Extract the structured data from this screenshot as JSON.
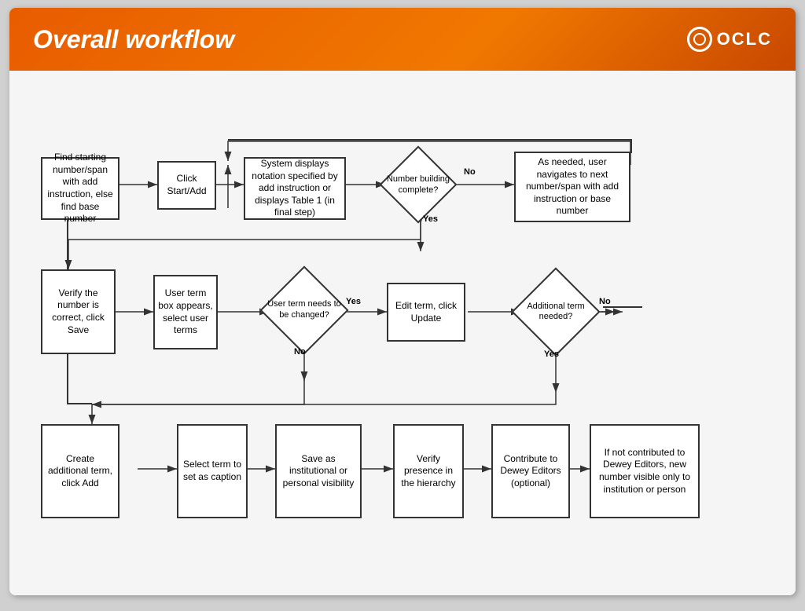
{
  "header": {
    "title": "Overall workflow",
    "logo_text": "OCLC"
  },
  "flowchart": {
    "row1_boxes": [
      {
        "id": "b1",
        "text": "Find starting number/span with add instruction, else find base number"
      },
      {
        "id": "b2",
        "text": "Click Start/Add"
      },
      {
        "id": "b3",
        "text": "System displays notation specified by add instruction or displays Table 1 (in final step)"
      },
      {
        "id": "d1",
        "text": "Number building complete?",
        "type": "diamond"
      },
      {
        "id": "b4",
        "text": "As needed, user navigates to next number/span with add instruction or base number"
      }
    ],
    "row2_boxes": [
      {
        "id": "b5",
        "text": "Verify the number is correct, click Save"
      },
      {
        "id": "b6",
        "text": "User term box appears, select user terms"
      },
      {
        "id": "d2",
        "text": "User term needs to be changed?",
        "type": "diamond"
      },
      {
        "id": "b7",
        "text": "Edit term, click Update"
      },
      {
        "id": "d3",
        "text": "Additional term needed?",
        "type": "diamond"
      }
    ],
    "row3_boxes": [
      {
        "id": "b8",
        "text": "Create additional term, click Add"
      },
      {
        "id": "b9",
        "text": "Select term to set as caption"
      },
      {
        "id": "b10",
        "text": "Save as institutional or personal visibility"
      },
      {
        "id": "b11",
        "text": "Verify presence in the hierarchy"
      },
      {
        "id": "b12",
        "text": "Contribute to Dewey Editors (optional)"
      },
      {
        "id": "b13",
        "text": "If not contributed to Dewey Editors, new number visible only to institution or person"
      }
    ],
    "labels": {
      "yes": "Yes",
      "no": "No"
    }
  }
}
